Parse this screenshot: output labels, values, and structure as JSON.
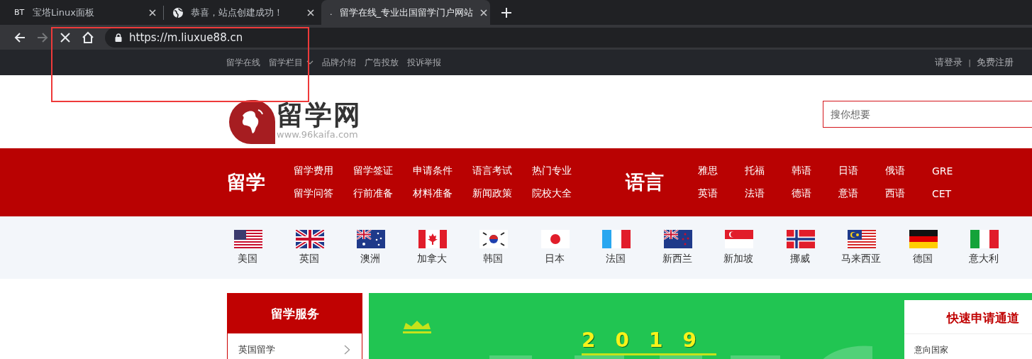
{
  "browser": {
    "tabs": [
      {
        "kind": "text",
        "favicon_text": "BT",
        "title": "宝塔Linux面板",
        "selected": false
      },
      {
        "kind": "globe",
        "title": "恭喜，站点创建成功！",
        "selected": false
      },
      {
        "kind": "text",
        "favicon_text": ".",
        "title": "留学在线_专业出国留学门户网站",
        "selected": true
      }
    ],
    "forward_enabled": false,
    "loading": true,
    "url": "https://m.liuxue88.cn"
  },
  "annotations": [
    {
      "kind": "rectangle"
    }
  ],
  "top_bar": {
    "left_links": [
      {
        "label": "留学在线",
        "dropdown": false
      },
      {
        "label": "留学栏目",
        "dropdown": true
      },
      {
        "label": "品牌介绍",
        "dropdown": false
      },
      {
        "label": "广告投放",
        "dropdown": false
      },
      {
        "label": "投诉举报",
        "dropdown": false
      }
    ],
    "right_links": [
      {
        "kind": "link",
        "label": "请登录"
      },
      {
        "kind": "separator",
        "label": "|"
      },
      {
        "kind": "link",
        "label": "免费注册"
      }
    ]
  },
  "header": {
    "logo_title": "留学网",
    "logo_subtitle": "www.96kaifa.com",
    "search": {
      "placeholder": "搜你想要"
    }
  },
  "nav": [
    {
      "heading": "留学",
      "links": [
        "留学费用",
        "留学签证",
        "申请条件",
        "语言考试",
        "热门专业",
        "留学问答",
        "行前准备",
        "材料准备",
        "新闻政策",
        "院校大全"
      ]
    },
    {
      "heading": "语言",
      "links": [
        "雅思",
        "托福",
        "韩语",
        "日语",
        "俄语",
        "GRE",
        "英语",
        "法语",
        "德语",
        "意语",
        "西语",
        "CET"
      ]
    }
  ],
  "countries": [
    {
      "kind": "us",
      "label": "美国"
    },
    {
      "kind": "uk",
      "label": "英国"
    },
    {
      "kind": "au",
      "label": "澳洲"
    },
    {
      "kind": "ca",
      "label": "加拿大"
    },
    {
      "kind": "kr",
      "label": "韩国"
    },
    {
      "kind": "jp",
      "label": "日本"
    },
    {
      "kind": "fr",
      "label": "法国"
    },
    {
      "kind": "nz",
      "label": "新西兰"
    },
    {
      "kind": "sg",
      "label": "新加坡"
    },
    {
      "kind": "no",
      "label": "挪威"
    },
    {
      "kind": "my",
      "label": "马来西亚"
    },
    {
      "kind": "de",
      "label": "德国"
    },
    {
      "kind": "it",
      "label": "意大利"
    }
  ],
  "sidebar": {
    "title": "留学服务",
    "items": [
      "英国留学"
    ]
  },
  "banner": {
    "year": "2019"
  },
  "quick_apply": {
    "title": "快速申请通道",
    "field_label": "意向国家"
  }
}
